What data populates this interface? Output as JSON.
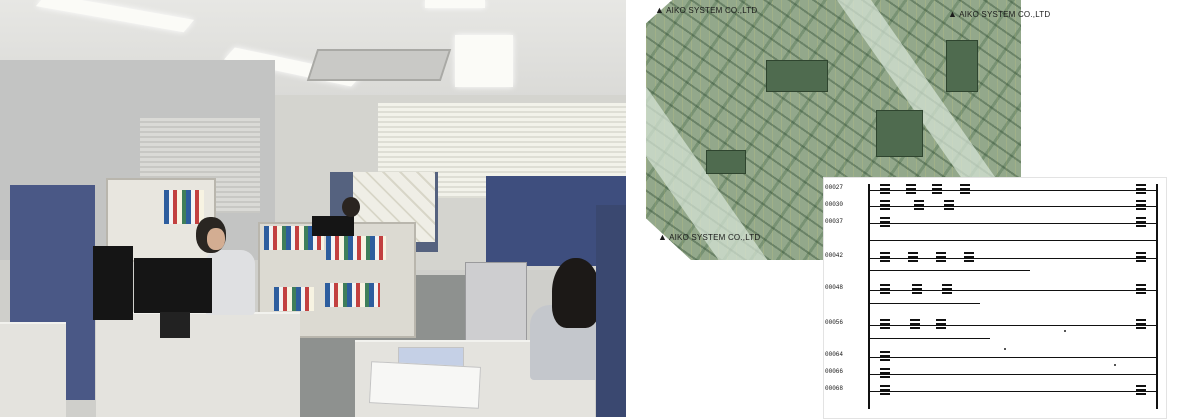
{
  "image": {
    "panels": [
      "office-photo",
      "pcb-layout",
      "ladder-diagram"
    ],
    "pcb_logo_text": [
      "AIKO SYSTEM CO.,LTD",
      "AIKO SYSTEM CO.,LTD",
      "AIKO SYSTEM CO.,LTD"
    ],
    "ladder_addresses": [
      "00027",
      "00030",
      "00037",
      "00042",
      "00048",
      "00056",
      "00064",
      "00066",
      "00068"
    ],
    "colors": {
      "partition": "#3e4e7e",
      "pcb": "#93a88b",
      "paper": "#ffffff"
    }
  }
}
